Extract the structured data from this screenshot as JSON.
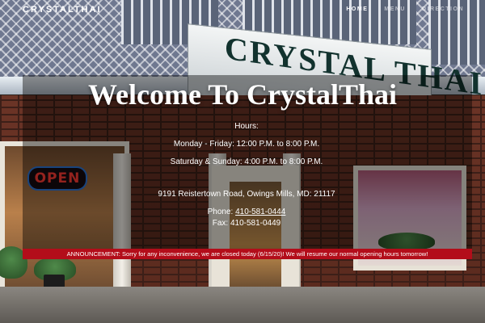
{
  "header": {
    "brand": "CRYSTALTHAI",
    "nav": [
      {
        "label": "HOME",
        "active": true
      },
      {
        "label": "MENU",
        "active": false
      },
      {
        "label": "DIRECTION",
        "active": false
      }
    ]
  },
  "hero": {
    "title": "Welcome To CrystalThai",
    "hours_heading": "Hours:",
    "weekday_hours": "Monday - Friday: 12:00 P.M. to 8:00 P.M.",
    "weekend_hours": "Saturday & Sunday: 4:00 P.M. to 8:00 P.M.",
    "address": "9191 Reistertown Road, Owings Mills, MD: 21117",
    "phone_label": "Phone: ",
    "phone_number": "410-581-0444",
    "fax": "Fax: 410-581-0449",
    "announcement": "ANNOUNCEMENT: Sorry for any inconvenience, we are closed today (6/15/20)! We will resume our normal opening hours tomorrow!"
  },
  "background": {
    "storefront_sign": "CRYSTAL THAI",
    "open_sign": "OPEN"
  },
  "colors": {
    "announcement_bg": "#b30d1a",
    "text": "#ffffff",
    "nav_inactive": "rgba(255,255,255,0.55)"
  }
}
